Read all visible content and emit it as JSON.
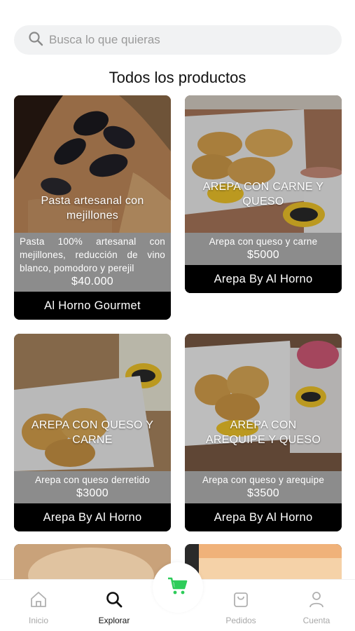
{
  "search": {
    "placeholder": "Busca lo que quieras"
  },
  "section_title": "Todos los productos",
  "products": [
    {
      "name": "Pasta artesanal con mejillones",
      "description": "Pasta 100% artesanal con mejillones, reducción de vino blanco, pomodoro y perejil",
      "price": "$40.000",
      "store": "Al Horno Gourmet"
    },
    {
      "name": "AREPA CON CARNE Y QUESO",
      "description": "Arepa con queso y carne",
      "price": "$5000",
      "store": "Arepa By Al Horno"
    },
    {
      "name": "AREPA CON QUESO Y CARNE",
      "description": "Arepa con queso derretido",
      "price": "$3000",
      "store": "Arepa By Al Horno"
    },
    {
      "name": "AREPA CON AREQUIPE Y QUESO",
      "description": "Arepa con queso y arequipe",
      "price": "$3500",
      "store": "Arepa By Al Horno"
    }
  ],
  "nav": {
    "home": "Inicio",
    "explore": "Explorar",
    "orders": "Pedidos",
    "account": "Cuenta"
  },
  "colors": {
    "cart_green": "#2ecc5a",
    "info_gray": "#8c8c8c",
    "store_bar": "#000000"
  }
}
